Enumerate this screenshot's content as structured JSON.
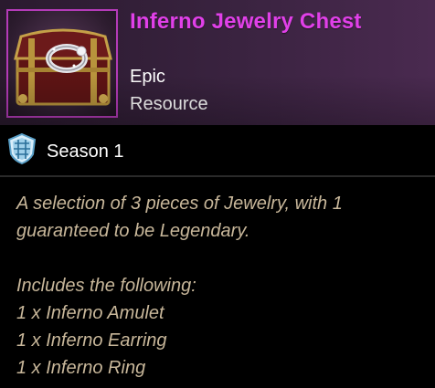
{
  "item": {
    "name": "Inferno Jewelry Chest",
    "rarity": "Epic",
    "category": "Resource",
    "season_label": "Season 1",
    "icon": "jewelry-chest-icon"
  },
  "description": {
    "line1": "A selection of 3 pieces of Jewelry, with 1",
    "line2": "guaranteed to be Legendary.",
    "includes_heading": "Includes the following:",
    "contents": [
      "1 x Inferno Amulet",
      "1 x Inferno Earring",
      "1 x Inferno Ring"
    ]
  },
  "colors": {
    "name": "#e040e8",
    "frame": "#b43bb8",
    "description": "#c8b79a",
    "header_bg": "#3a2340"
  }
}
